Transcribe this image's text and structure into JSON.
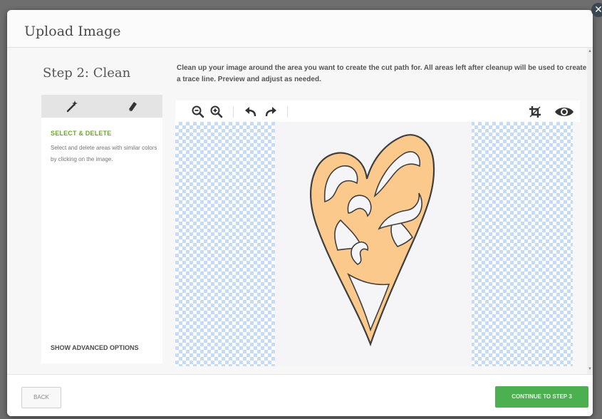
{
  "dialog": {
    "title": "Upload Image",
    "close_symbol": "✕"
  },
  "step": {
    "title": "Step 2: Clean",
    "instructions": "Clean up your image around the area you want to create the cut path for. All areas left after cleanup will be used to create a trace line. Preview and adjust as needed."
  },
  "tools": {
    "tabs": [
      {
        "icon": "magic-wand-icon"
      },
      {
        "icon": "eraser-icon"
      }
    ],
    "active_heading": "SELECT & DELETE",
    "active_description": "Select and delete areas with similar colors by clicking on the image.",
    "advanced_link": "SHOW ADVANCED OPTIONS"
  },
  "toolbar": {
    "buttons": [
      "zoom-out-icon",
      "zoom-in-icon",
      "undo-icon",
      "redo-icon",
      "crop-icon",
      "preview-eye-icon"
    ]
  },
  "image": {
    "fill_color": "#fbc98c",
    "stroke_color": "#3f3f3f"
  },
  "footer": {
    "back_label": "BACK",
    "continue_label": "CONTINUE TO STEP 3",
    "continue_color": "#4caf50"
  }
}
